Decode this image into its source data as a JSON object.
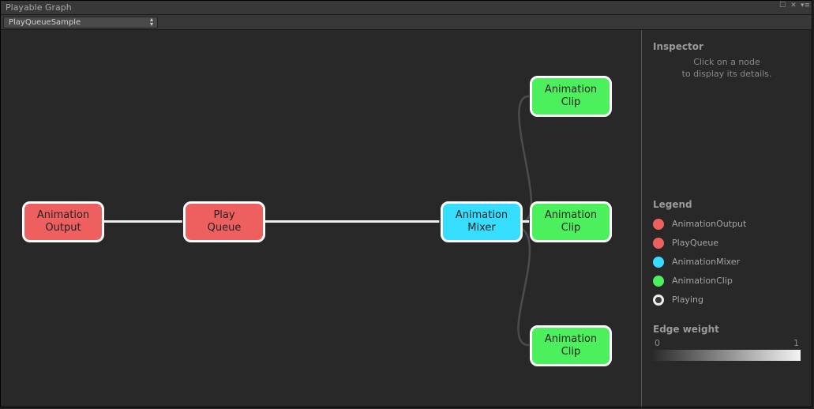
{
  "window": {
    "title": "Playable Graph"
  },
  "toolbar": {
    "graph_selector": "PlayQueueSample"
  },
  "inspector": {
    "heading": "Inspector",
    "hint_line1": "Click on a node",
    "hint_line2": "to display its details."
  },
  "legend": {
    "heading": "Legend",
    "items": [
      {
        "label": "AnimationOutput",
        "swatch": "sw-red"
      },
      {
        "label": "PlayQueue",
        "swatch": "sw-red"
      },
      {
        "label": "AnimationMixer",
        "swatch": "sw-cyan"
      },
      {
        "label": "AnimationClip",
        "swatch": "sw-green"
      },
      {
        "label": "Playing",
        "swatch": "sw-playing"
      }
    ]
  },
  "edge_weight": {
    "heading": "Edge weight",
    "min": "0",
    "max": "1"
  },
  "nodes": {
    "output": {
      "line1": "Animation",
      "line2": "Output"
    },
    "queue": {
      "line1": "Play",
      "line2": "Queue"
    },
    "mixer": {
      "line1": "Animation",
      "line2": "Mixer"
    },
    "clip1": {
      "line1": "Animation",
      "line2": "Clip"
    },
    "clip2": {
      "line1": "Animation",
      "line2": "Clip"
    },
    "clip3": {
      "line1": "Animation",
      "line2": "Clip"
    }
  }
}
